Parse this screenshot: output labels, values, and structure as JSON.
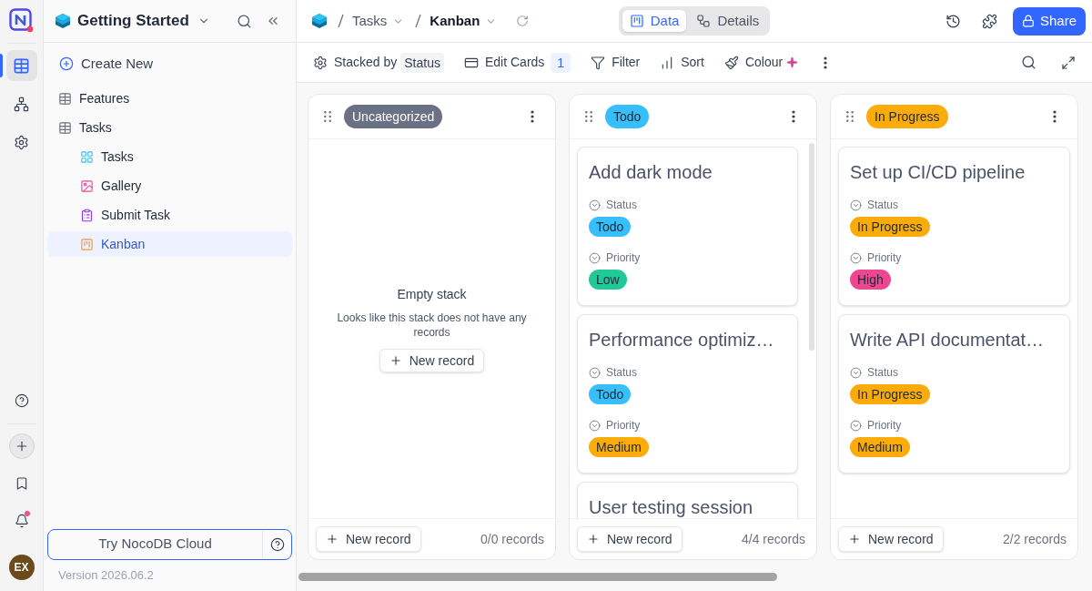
{
  "rail": {
    "top": [
      {
        "kind": "tables",
        "selected": true
      },
      {
        "kind": "erd",
        "selected": false
      },
      {
        "kind": "settings",
        "selected": false
      }
    ],
    "bottom": [
      {
        "kind": "help",
        "badge": false
      },
      {
        "kind": "add",
        "badge": false
      },
      {
        "kind": "bookmark",
        "badge": false
      },
      {
        "kind": "notifications",
        "badge": true
      }
    ],
    "avatar": "EX"
  },
  "sidebar": {
    "base_title": "Getting Started",
    "create_new": "Create New",
    "items": [
      {
        "kind": "table",
        "label": "Features",
        "selected": false
      },
      {
        "kind": "table",
        "label": "Tasks",
        "selected": false,
        "children": [
          {
            "kind": "grid",
            "label": "Tasks",
            "selected": false
          },
          {
            "kind": "gallery",
            "label": "Gallery",
            "selected": false
          },
          {
            "kind": "form",
            "label": "Submit Task",
            "selected": false
          },
          {
            "kind": "kanban",
            "label": "Kanban",
            "selected": true
          }
        ]
      }
    ],
    "cloud_button": "Try NocoDB Cloud",
    "version": "Version 2026.06.2"
  },
  "topbar": {
    "breadcrumbs": [
      {
        "label": "Tasks",
        "current": false
      },
      {
        "label": "Kanban",
        "current": true
      }
    ],
    "tabs": [
      {
        "kind": "data",
        "label": "Data",
        "selected": true
      },
      {
        "kind": "details",
        "label": "Details",
        "selected": false
      }
    ],
    "share": "Share"
  },
  "toolbar": {
    "items": [
      {
        "kind": "stacked",
        "label": "Stacked by",
        "value": "Status"
      },
      {
        "kind": "edit_cards",
        "label": "Edit Cards",
        "count": "1"
      },
      {
        "kind": "filter",
        "label": "Filter"
      },
      {
        "kind": "sort",
        "label": "Sort"
      },
      {
        "kind": "colour",
        "label": "Colour"
      }
    ]
  },
  "stacks": [
    {
      "title": "Uncategorized",
      "color": "#6a7184",
      "scrollable": false,
      "empty": {
        "title": "Empty stack",
        "text": "Looks like this stack does not have any records",
        "button": "New record"
      },
      "new_record": "New record",
      "count": "0/0 records"
    },
    {
      "title": "Todo",
      "color": "#36bffa",
      "scrollable": true,
      "cards": [
        {
          "title": "Add dark mode",
          "fields": [
            {
              "label": "Status",
              "value": "Todo",
              "color": "#36bffa"
            },
            {
              "label": "Priority",
              "value": "Low",
              "color": "#20c997"
            }
          ]
        },
        {
          "title": "Performance optimiz…",
          "fields": [
            {
              "label": "Status",
              "value": "Todo",
              "color": "#36bffa"
            },
            {
              "label": "Priority",
              "value": "Medium",
              "color": "#fbab0a"
            }
          ]
        },
        {
          "title": "User testing session"
        }
      ],
      "new_record": "New record",
      "count": "4/4 records"
    },
    {
      "title": "In Progress",
      "color": "#fbab0a",
      "scrollable": false,
      "cards": [
        {
          "title": "Set up CI/CD pipeline",
          "fields": [
            {
              "label": "Status",
              "value": "In Progress",
              "color": "#fbab0a"
            },
            {
              "label": "Priority",
              "value": "High",
              "color": "#ec4892"
            }
          ]
        },
        {
          "title": "Write API documentat…",
          "fields": [
            {
              "label": "Status",
              "value": "In Progress",
              "color": "#fbab0a"
            },
            {
              "label": "Priority",
              "value": "Medium",
              "color": "#fbab0a"
            }
          ]
        }
      ],
      "new_record": "New record",
      "count": "2/2 records"
    }
  ]
}
